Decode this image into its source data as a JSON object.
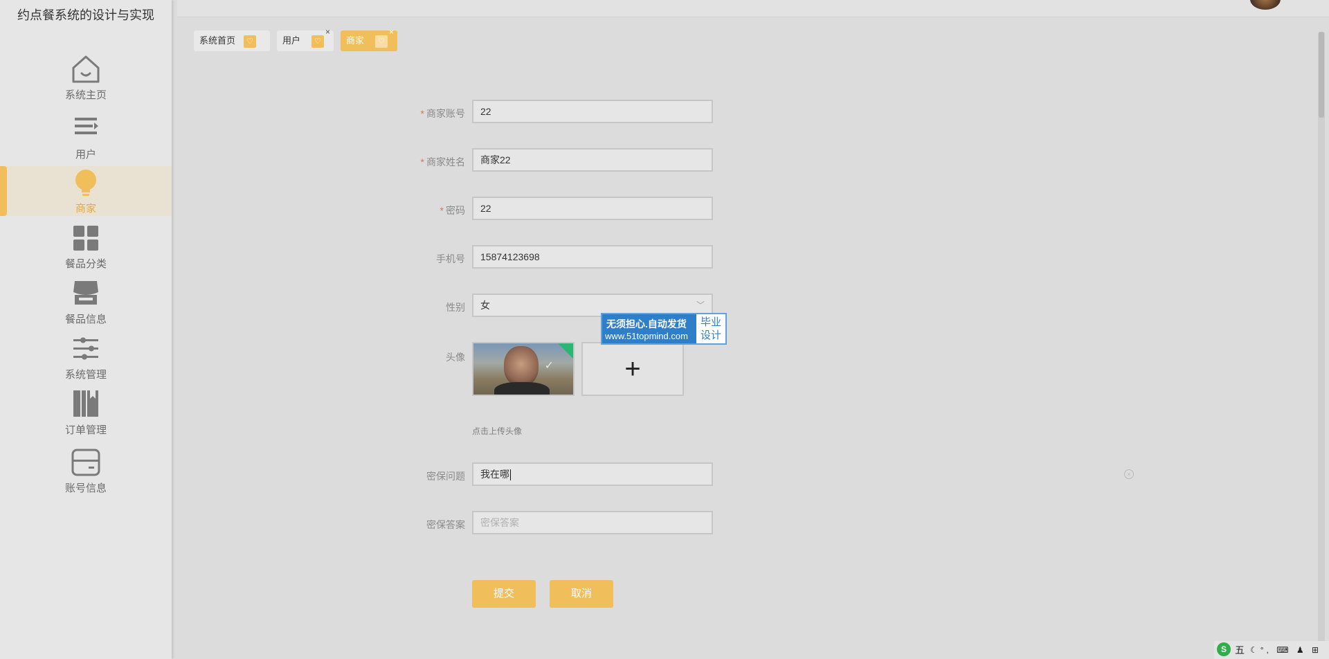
{
  "app": {
    "title": "约点餐系统的设计与实现"
  },
  "sidebar": {
    "items": [
      {
        "label": "系统主页",
        "icon": "home-icon",
        "active": false
      },
      {
        "label": "用户",
        "icon": "list-icon",
        "active": false
      },
      {
        "label": "商家",
        "icon": "bulb-icon",
        "active": true
      },
      {
        "label": "餐品分类",
        "icon": "grid-icon",
        "active": false
      },
      {
        "label": "餐品信息",
        "icon": "shop-icon",
        "active": false
      },
      {
        "label": "系统管理",
        "icon": "sliders-icon",
        "active": false
      },
      {
        "label": "订单管理",
        "icon": "books-icon",
        "active": false
      },
      {
        "label": "账号信息",
        "icon": "card-icon",
        "active": false
      }
    ],
    "active_color": "#e8aa3c"
  },
  "tabs": [
    {
      "label": "系统首页",
      "closable": false,
      "current": false
    },
    {
      "label": "用户",
      "closable": true,
      "current": false
    },
    {
      "label": "商家",
      "closable": true,
      "current": true
    }
  ],
  "form": {
    "account": {
      "label": "商家账号",
      "value": "22",
      "required": true
    },
    "name": {
      "label": "商家姓名",
      "value": "商家22",
      "required": true
    },
    "password": {
      "label": "密码",
      "value": "22",
      "required": true
    },
    "phone": {
      "label": "手机号",
      "value": "15874123698",
      "required": false
    },
    "gender": {
      "label": "性别",
      "value": "女",
      "required": false
    },
    "avatar": {
      "label": "头像",
      "hint": "点击上传头像"
    },
    "question": {
      "label": "密保问题",
      "value": "我在哪",
      "required": false
    },
    "answer": {
      "label": "密保答案",
      "placeholder": "密保答案",
      "required": false
    },
    "submit_label": "提交",
    "cancel_label": "取消"
  },
  "watermark": {
    "line1": "无须担心.自动发货",
    "line2": "www.51topmind.com",
    "right_line1": "毕业",
    "right_line2": "设计"
  },
  "taskbar": {
    "logo": "S",
    "ime": "五",
    "icons": "☾°, ⌨ ♟ ⊞"
  },
  "colors": {
    "accent": "#f0be5b",
    "required": "#e26d5c",
    "watermark_blue": "#2f7fc8"
  }
}
